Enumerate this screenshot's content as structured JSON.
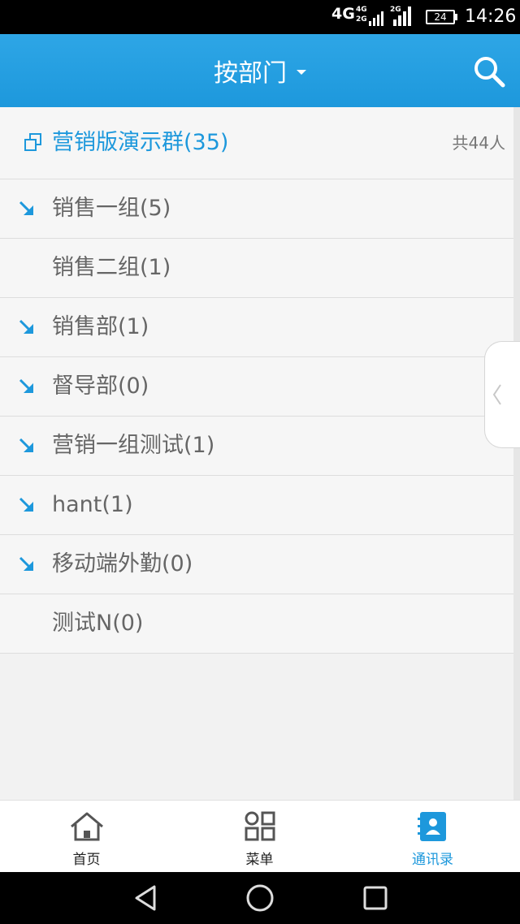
{
  "status_bar": {
    "network": "4G",
    "net_a": "4G",
    "net_b": "2G",
    "net_c": "2G",
    "battery": "24",
    "time": "14:26"
  },
  "header": {
    "title": "按部门"
  },
  "group": {
    "name": "营销版演示群(35)",
    "total": "共44人"
  },
  "departments": [
    {
      "label": "销售一组(5)",
      "expandable": true
    },
    {
      "label": "销售二组(1)",
      "expandable": false
    },
    {
      "label": "销售部(1)",
      "expandable": true
    },
    {
      "label": "督导部(0)",
      "expandable": true
    },
    {
      "label": "营销一组测试(1)",
      "expandable": true
    },
    {
      "label": "hant(1)",
      "expandable": true
    },
    {
      "label": "移动端外勤(0)",
      "expandable": true
    },
    {
      "label": "测试N(0)",
      "expandable": false
    }
  ],
  "tabs": [
    {
      "label": "首页",
      "icon": "home-icon"
    },
    {
      "label": "菜单",
      "icon": "grid-icon"
    },
    {
      "label": "通讯录",
      "icon": "contacts-icon"
    }
  ],
  "colors": {
    "accent": "#1d98dc",
    "text": "#666666"
  }
}
